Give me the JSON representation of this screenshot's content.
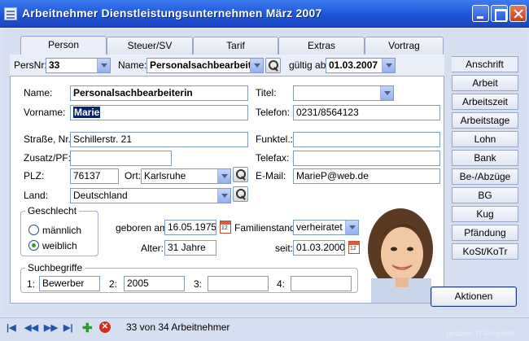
{
  "window": {
    "title": "Arbeitnehmer Dienstleistungsunternehmen März 2007"
  },
  "tabs": [
    "Person",
    "Steuer/SV",
    "Tarif",
    "Extras",
    "Vortrag"
  ],
  "top": {
    "persnr_label": "PersNr:",
    "persnr_value": "33",
    "name_label": "Name:",
    "name_value": "Personalsachbearbeite",
    "gueltig_label": "gültig ab:",
    "gueltig_value": "01.03.2007"
  },
  "form": {
    "name_label": "Name:",
    "name_value": "Personalsachbearbeiterin",
    "vorname_label": "Vorname:",
    "vorname_value": "Marie",
    "strasse_label": "Straße, Nr.:",
    "strasse_value": "Schillerstr. 21",
    "zusatz_label": "Zusatz/PF:",
    "zusatz_value": "",
    "plz_label": "PLZ:",
    "plz_value": "76137",
    "ort_label": "Ort:",
    "ort_value": "Karlsruhe",
    "land_label": "Land:",
    "land_value": "Deutschland",
    "titel_label": "Titel:",
    "titel_value": "",
    "telefon_label": "Telefon:",
    "telefon_value": "0231/8564123",
    "funktel_label": "Funktel.:",
    "funktel_value": "",
    "telefax_label": "Telefax:",
    "telefax_value": "",
    "email_label": "E-Mail:",
    "email_value": "MarieP@web.de"
  },
  "geschlecht": {
    "title": "Geschlecht",
    "options": [
      "männlich",
      "weiblich"
    ],
    "selected": "weiblich"
  },
  "personal": {
    "geboren_label": "geboren am:",
    "geboren_value": "16.05.1975",
    "alter_label": "Alter:",
    "alter_value": "31 Jahre",
    "familienstand_label": "Familienstand:",
    "familienstand_value": "verheiratet",
    "seit_label": "seit:",
    "seit_value": "01.03.2000"
  },
  "suchbegriffe": {
    "title": "Suchbegriffe",
    "items": [
      {
        "label": "1:",
        "value": "Bewerber"
      },
      {
        "label": "2:",
        "value": "2005"
      },
      {
        "label": "3:",
        "value": ""
      },
      {
        "label": "4:",
        "value": ""
      }
    ]
  },
  "right_tabs": [
    "Anschrift",
    "Arbeit",
    "Arbeitszeit",
    "Arbeitstage",
    "Lohn",
    "Bank",
    "Be-/Abzüge",
    "BG",
    "Kug",
    "Pfändung",
    "KoSt/KoTr"
  ],
  "aktionen_label": "Aktionen",
  "status": {
    "record_text": "33 von 34 Arbeitnehmer",
    "copyright": "gedeon IT-Projekte"
  }
}
